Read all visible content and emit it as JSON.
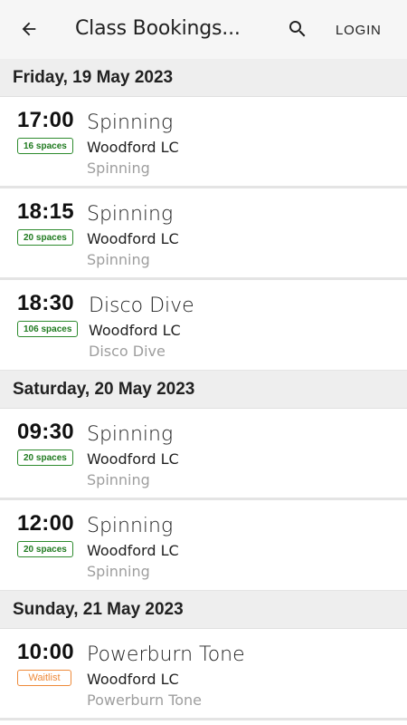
{
  "appbar": {
    "title": "Class Bookings...",
    "login_label": "LOGIN"
  },
  "days": [
    {
      "label": "Friday, 19 May 2023",
      "sessions": [
        {
          "time": "17:00",
          "badge": "16 spaces",
          "badge_type": "spaces",
          "name": "Spinning",
          "venue": "Woodford LC",
          "subtype": "Spinning"
        },
        {
          "time": "18:15",
          "badge": "20 spaces",
          "badge_type": "spaces",
          "name": "Spinning",
          "venue": "Woodford LC",
          "subtype": "Spinning"
        },
        {
          "time": "18:30",
          "badge": "106 spaces",
          "badge_type": "spaces",
          "name": "Disco Dive",
          "venue": "Woodford LC",
          "subtype": "Disco Dive"
        }
      ]
    },
    {
      "label": "Saturday, 20 May 2023",
      "sessions": [
        {
          "time": "09:30",
          "badge": "20 spaces",
          "badge_type": "spaces",
          "name": "Spinning",
          "venue": "Woodford LC",
          "subtype": "Spinning"
        },
        {
          "time": "12:00",
          "badge": "20 spaces",
          "badge_type": "spaces",
          "name": "Spinning",
          "venue": "Woodford LC",
          "subtype": "Spinning"
        }
      ]
    },
    {
      "label": "Sunday, 21 May 2023",
      "sessions": [
        {
          "time": "10:00",
          "badge": "Waitlist",
          "badge_type": "waitlist",
          "name": "Powerburn Tone",
          "venue": "Woodford LC",
          "subtype": "Powerburn Tone"
        }
      ]
    }
  ],
  "colors": {
    "spaces_badge": "#2e8b2e",
    "waitlist_badge": "#ee8a3a",
    "header_bg": "#eeeeee",
    "appbar_bg": "#f6f6f6"
  },
  "icons": {
    "back": "arrow-left-icon",
    "search": "search-icon"
  }
}
